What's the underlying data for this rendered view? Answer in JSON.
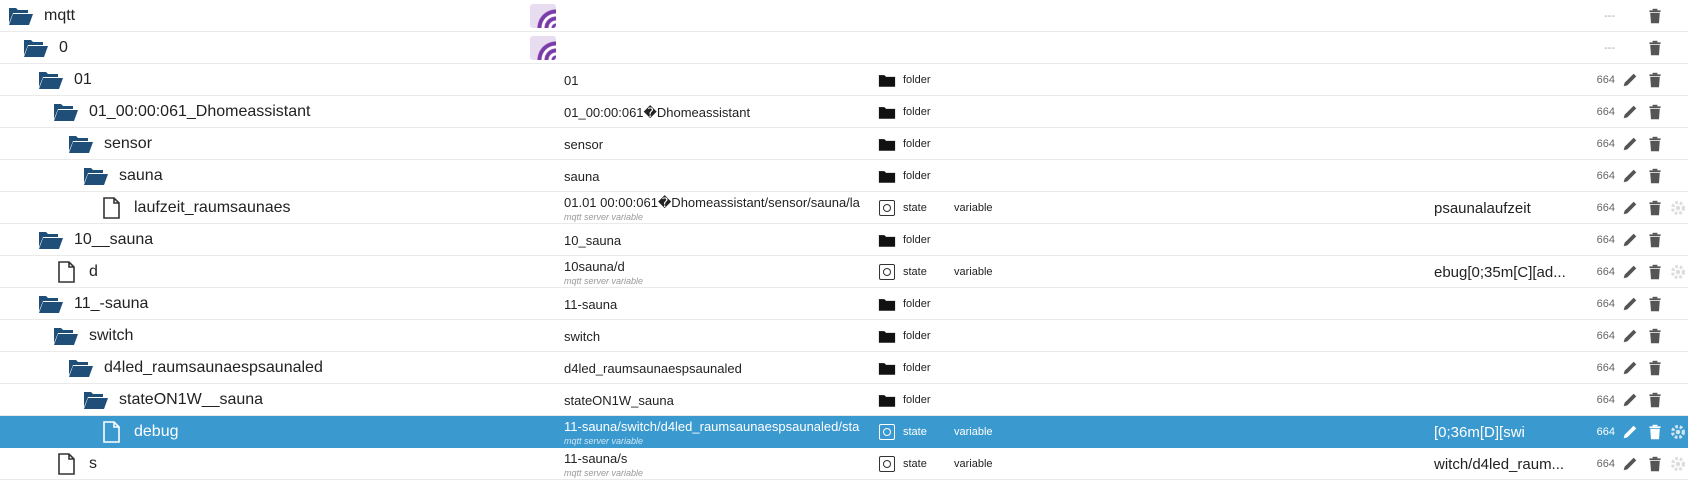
{
  "rows": [
    {
      "label": "mqtt",
      "depth": 0,
      "icon": "folder-open-icon",
      "showSym": true,
      "acl": "---",
      "dash": true,
      "edit": false
    },
    {
      "label": "0",
      "depth": 1,
      "icon": "folder-open-icon",
      "showSym": true,
      "acl": "---",
      "dash": true,
      "edit": false
    },
    {
      "label": "01",
      "depth": 2,
      "icon": "folder-open-icon",
      "id": "01",
      "typeIcon": "folder-icon",
      "type": "folder",
      "acl": "664",
      "edit": true
    },
    {
      "label": "01_00:00:061_Dhomeassistant",
      "depth": 3,
      "icon": "folder-open-icon",
      "id": "01_00:00:061�Dhomeassistant",
      "typeIcon": "folder-icon",
      "type": "folder",
      "acl": "664",
      "edit": true
    },
    {
      "label": "sensor",
      "depth": 4,
      "icon": "folder-open-icon",
      "id": "sensor",
      "typeIcon": "folder-icon",
      "type": "folder",
      "acl": "664",
      "edit": true
    },
    {
      "label": "sauna",
      "depth": 5,
      "icon": "folder-open-icon",
      "id": "sauna",
      "typeIcon": "folder-icon",
      "type": "folder",
      "acl": "664",
      "edit": true
    },
    {
      "label": "laufzeit_raumsaunaes",
      "depth": 6,
      "icon": "file-icon",
      "id": "01.01 00:00:061�Dhomeassistant/sensor/sauna/la",
      "sub": "mqtt server variable",
      "typeIcon": "state-icon",
      "type": "state",
      "role": "variable",
      "value": "psaunalaufzeit",
      "acl": "664",
      "edit": true,
      "gear": true
    },
    {
      "label": "10__sauna",
      "depth": 2,
      "icon": "folder-open-icon",
      "id": "10_sauna",
      "typeIcon": "folder-icon",
      "type": "folder",
      "acl": "664",
      "edit": true
    },
    {
      "label": "d",
      "depth": 3,
      "icon": "file-icon",
      "id": "10sauna/d",
      "sub": "mqtt server variable",
      "typeIcon": "state-icon",
      "type": "state",
      "role": "variable",
      "value": "ebug[0;35m[C][ad...",
      "acl": "664",
      "edit": true,
      "gear": true
    },
    {
      "label": "11_-sauna",
      "depth": 2,
      "icon": "folder-open-icon",
      "id": "11-sauna",
      "typeIcon": "folder-icon",
      "type": "folder",
      "acl": "664",
      "edit": true
    },
    {
      "label": "switch",
      "depth": 3,
      "icon": "folder-open-icon",
      "id": "switch",
      "typeIcon": "folder-icon",
      "type": "folder",
      "acl": "664",
      "edit": true
    },
    {
      "label": "d4led_raumsaunaespsaunaled",
      "depth": 4,
      "icon": "folder-open-icon",
      "id": "d4led_raumsaunaespsaunaled",
      "typeIcon": "folder-icon",
      "type": "folder",
      "acl": "664",
      "edit": true
    },
    {
      "label": "stateON1W__sauna",
      "depth": 5,
      "icon": "folder-open-icon",
      "id": "stateON1W_sauna",
      "typeIcon": "folder-icon",
      "type": "folder",
      "acl": "664",
      "edit": true
    },
    {
      "label": "debug",
      "depth": 6,
      "icon": "file-icon",
      "id": "11-sauna/switch/d4led_raumsaunaespsaunaled/sta",
      "sub": "mqtt server variable",
      "typeIcon": "state-icon",
      "type": "state",
      "role": "variable",
      "value": "[0;36m[D][swi",
      "acl": "664",
      "edit": true,
      "gear": true,
      "selected": true
    },
    {
      "label": "s",
      "depth": 3,
      "icon": "file-icon",
      "id": "11-sauna/s",
      "sub": "mqtt server variable",
      "typeIcon": "state-icon",
      "type": "state",
      "role": "variable",
      "value": "witch/d4led_raum...",
      "acl": "664",
      "edit": true,
      "gear": true
    }
  ],
  "colors": {
    "folder": "#1f4e79",
    "selected": "#3a99cf",
    "logo": "#7a3aa8",
    "action": "#555555"
  }
}
